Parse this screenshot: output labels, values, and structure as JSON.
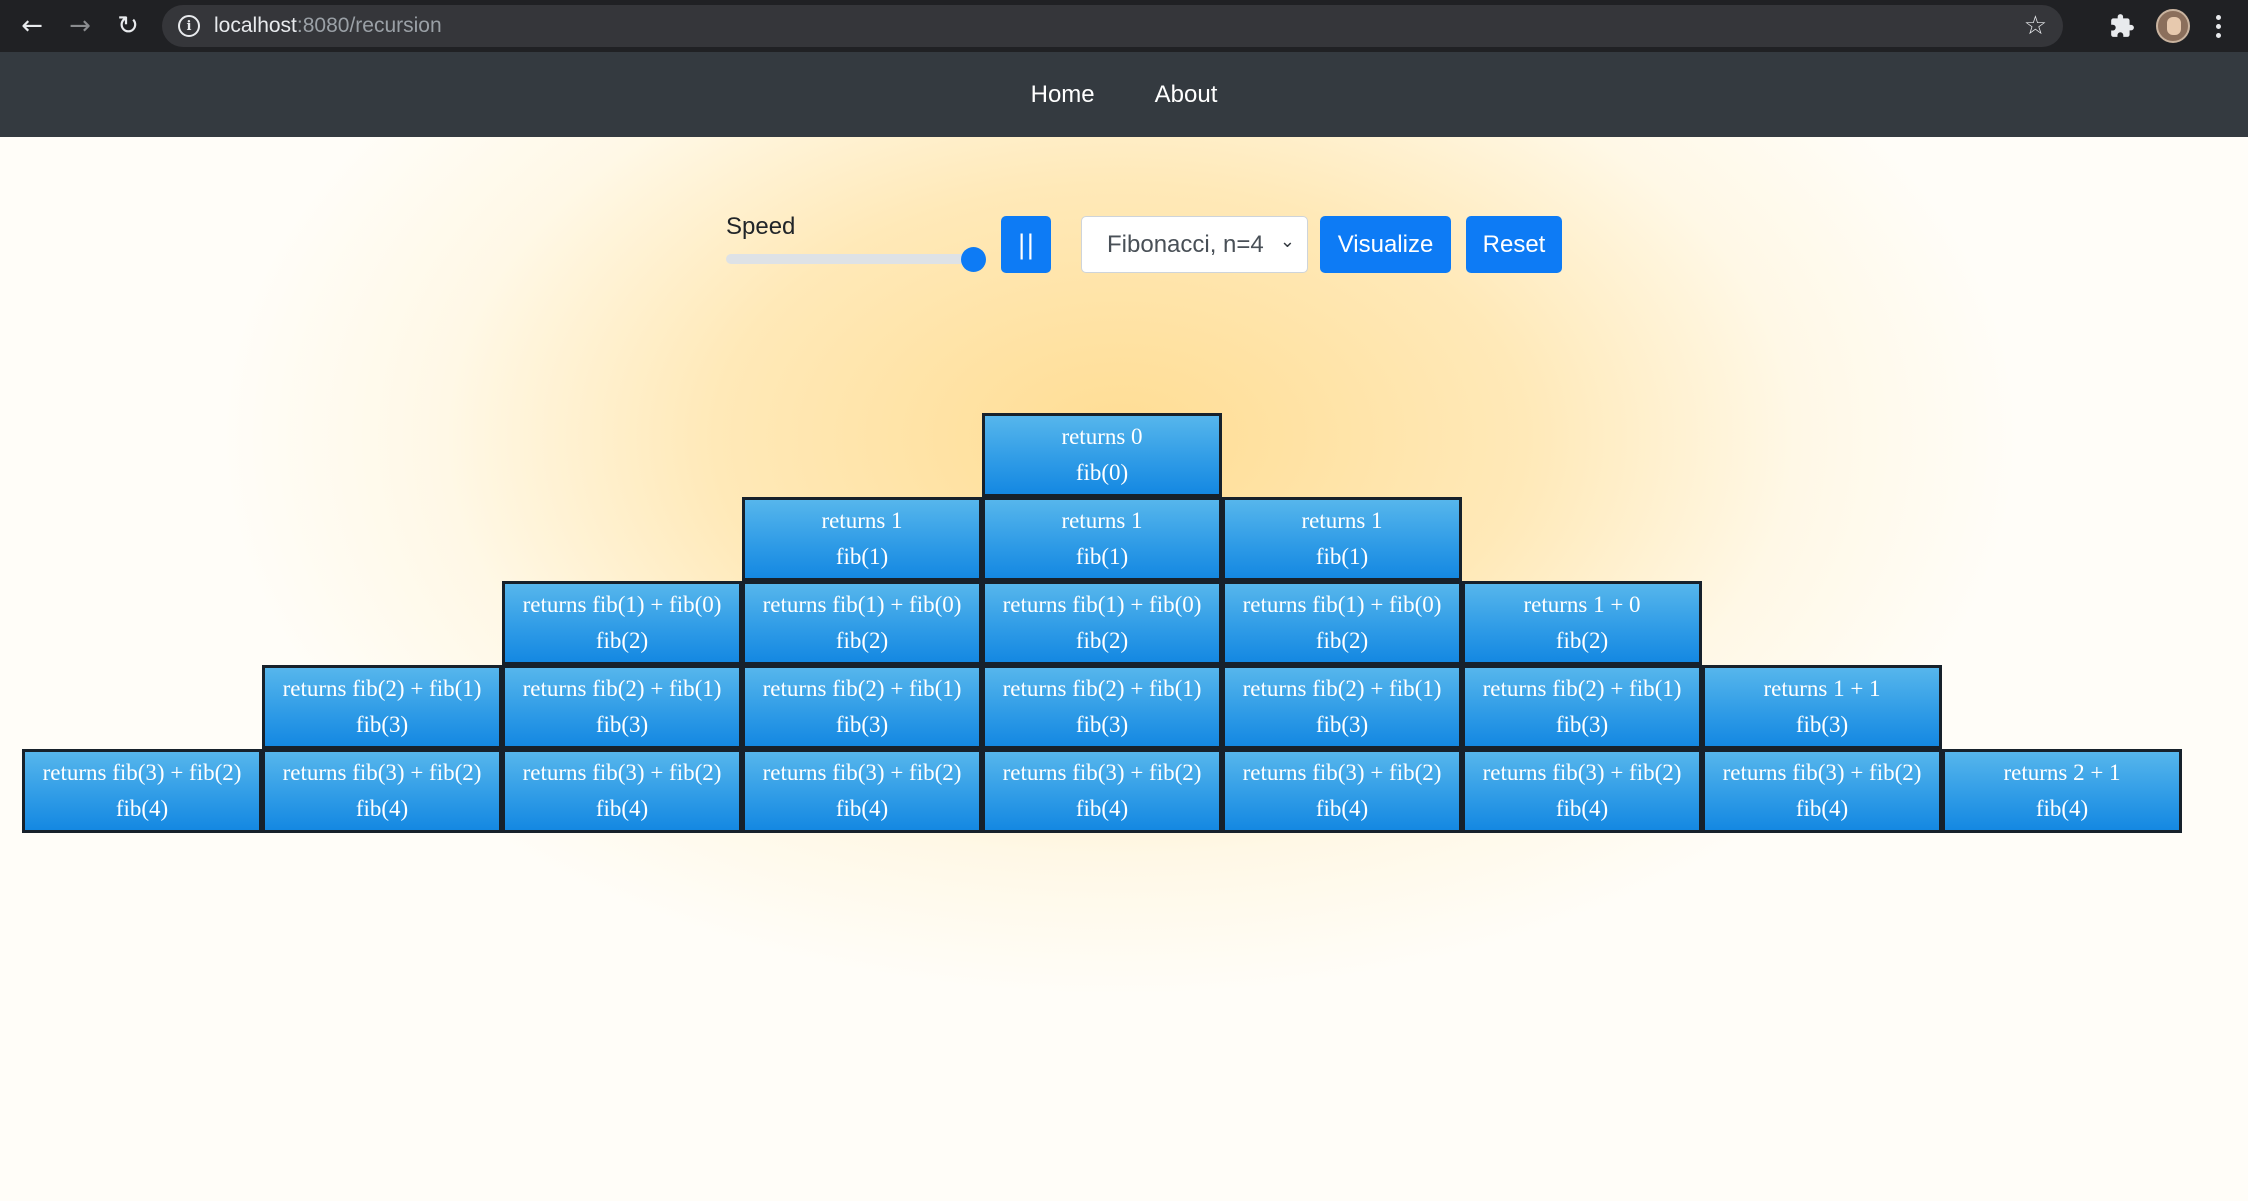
{
  "browser": {
    "url_host": "localhost",
    "url_path": ":8080/recursion"
  },
  "navbar": {
    "links": [
      "Home",
      "About"
    ]
  },
  "controls": {
    "speed_label": "Speed",
    "speed_value": 1.0,
    "pause_label": "||",
    "algorithm_selected": "Fibonacci, n=4",
    "visualize_label": "Visualize",
    "reset_label": "Reset"
  },
  "stack_rows": [
    [
      {
        "ret": "returns 0",
        "call": "fib(0)"
      }
    ],
    [
      {
        "ret": "returns 1",
        "call": "fib(1)"
      },
      {
        "ret": "returns 1",
        "call": "fib(1)"
      },
      {
        "ret": "returns 1",
        "call": "fib(1)"
      }
    ],
    [
      {
        "ret": "returns fib(1) + fib(0)",
        "call": "fib(2)"
      },
      {
        "ret": "returns fib(1) + fib(0)",
        "call": "fib(2)"
      },
      {
        "ret": "returns fib(1) + fib(0)",
        "call": "fib(2)"
      },
      {
        "ret": "returns fib(1) + fib(0)",
        "call": "fib(2)"
      },
      {
        "ret": "returns 1 + 0",
        "call": "fib(2)"
      }
    ],
    [
      {
        "ret": "returns fib(2) + fib(1)",
        "call": "fib(3)"
      },
      {
        "ret": "returns fib(2) + fib(1)",
        "call": "fib(3)"
      },
      {
        "ret": "returns fib(2) + fib(1)",
        "call": "fib(3)"
      },
      {
        "ret": "returns fib(2) + fib(1)",
        "call": "fib(3)"
      },
      {
        "ret": "returns fib(2) + fib(1)",
        "call": "fib(3)"
      },
      {
        "ret": "returns fib(2) + fib(1)",
        "call": "fib(3)"
      },
      {
        "ret": "returns 1 + 1",
        "call": "fib(3)"
      }
    ],
    [
      {
        "ret": "returns fib(3) + fib(2)",
        "call": "fib(4)"
      },
      {
        "ret": "returns fib(3) + fib(2)",
        "call": "fib(4)"
      },
      {
        "ret": "returns fib(3) + fib(2)",
        "call": "fib(4)"
      },
      {
        "ret": "returns fib(3) + fib(2)",
        "call": "fib(4)"
      },
      {
        "ret": "returns fib(3) + fib(2)",
        "call": "fib(4)"
      },
      {
        "ret": "returns fib(3) + fib(2)",
        "call": "fib(4)"
      },
      {
        "ret": "returns fib(3) + fib(2)",
        "call": "fib(4)"
      },
      {
        "ret": "returns fib(3) + fib(2)",
        "call": "fib(4)"
      },
      {
        "ret": "returns 2 + 1",
        "call": "fib(4)"
      }
    ]
  ]
}
